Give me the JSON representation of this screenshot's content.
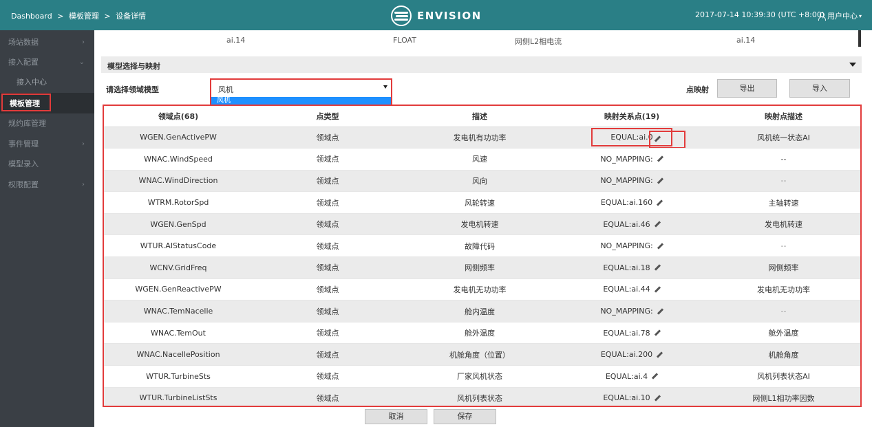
{
  "header": {
    "breadcrumb": [
      "Dashboard",
      "模板管理",
      "设备详情"
    ],
    "breadcrumb_sep": ">",
    "logo_text": "ENVISION",
    "datetime": "2017-07-14 10:39:30 (UTC +8:00)",
    "user_menu": "用户中心",
    "colors": {
      "topbar_bg": "#2a7f86",
      "sidebar_bg": "#3a3f45",
      "highlight": "#e23b3b"
    }
  },
  "sidebar": {
    "items": [
      {
        "label": "场站数据",
        "chevron": "›"
      },
      {
        "label": "接入配置",
        "chevron": "⌄"
      },
      {
        "label": "接入中心",
        "chevron": ""
      },
      {
        "label": "模板管理",
        "chevron": ""
      },
      {
        "label": "规约库管理",
        "chevron": ""
      },
      {
        "label": "事件管理",
        "chevron": "›"
      },
      {
        "label": "模型录入",
        "chevron": ""
      },
      {
        "label": "权限配置",
        "chevron": "›"
      }
    ]
  },
  "top_row": {
    "col1": "ai.14",
    "col2": "FLOAT",
    "col3": "网侧L2相电流",
    "col4": "ai.14"
  },
  "section": {
    "title": "模型选择与映射"
  },
  "model": {
    "label": "请选择领域模型",
    "selected": "风机",
    "dropdown_option": "风机",
    "mapping_label": "点映射",
    "export_label": "导出",
    "import_label": "导入"
  },
  "table": {
    "headers": [
      "领域点(68)",
      "点类型",
      "描述",
      "映射关系点(19)",
      "映射点描述"
    ],
    "rows": [
      {
        "point": "WGEN.GenActivePW",
        "type": "领域点",
        "desc": "发电机有功功率",
        "mapping": "EQUAL:ai.0",
        "mapdesc": "风机统一状态AI"
      },
      {
        "point": "WNAC.WindSpeed",
        "type": "领域点",
        "desc": "风速",
        "mapping": "NO_MAPPING:",
        "mapdesc": "--"
      },
      {
        "point": "WNAC.WindDirection",
        "type": "领域点",
        "desc": "风向",
        "mapping": "NO_MAPPING:",
        "mapdesc": "--"
      },
      {
        "point": "WTRM.RotorSpd",
        "type": "领域点",
        "desc": "风轮转速",
        "mapping": "EQUAL:ai.160",
        "mapdesc": "主轴转速"
      },
      {
        "point": "WGEN.GenSpd",
        "type": "领域点",
        "desc": "发电机转速",
        "mapping": "EQUAL:ai.46",
        "mapdesc": "发电机转速"
      },
      {
        "point": "WTUR.AIStatusCode",
        "type": "领域点",
        "desc": "故障代码",
        "mapping": "NO_MAPPING:",
        "mapdesc": "--"
      },
      {
        "point": "WCNV.GridFreq",
        "type": "领域点",
        "desc": "网侧频率",
        "mapping": "EQUAL:ai.18",
        "mapdesc": "网侧频率"
      },
      {
        "point": "WGEN.GenReactivePW",
        "type": "领域点",
        "desc": "发电机无功功率",
        "mapping": "EQUAL:ai.44",
        "mapdesc": "发电机无功功率"
      },
      {
        "point": "WNAC.TemNacelle",
        "type": "领域点",
        "desc": "舱内温度",
        "mapping": "NO_MAPPING:",
        "mapdesc": "--"
      },
      {
        "point": "WNAC.TemOut",
        "type": "领域点",
        "desc": "舱外温度",
        "mapping": "EQUAL:ai.78",
        "mapdesc": "舱外温度"
      },
      {
        "point": "WNAC.NacellePosition",
        "type": "领域点",
        "desc": "机舱角度（位置）",
        "mapping": "EQUAL:ai.200",
        "mapdesc": "机舱角度"
      },
      {
        "point": "WTUR.TurbineSts",
        "type": "领域点",
        "desc": "厂家风机状态",
        "mapping": "EQUAL:ai.4",
        "mapdesc": "风机列表状态AI"
      },
      {
        "point": "WTUR.TurbineListSts",
        "type": "领域点",
        "desc": "风机列表状态",
        "mapping": "EQUAL:ai.10",
        "mapdesc": "网侧L1相功率因数"
      }
    ]
  },
  "footer": {
    "cancel_label": "取消",
    "save_label": "保存"
  }
}
